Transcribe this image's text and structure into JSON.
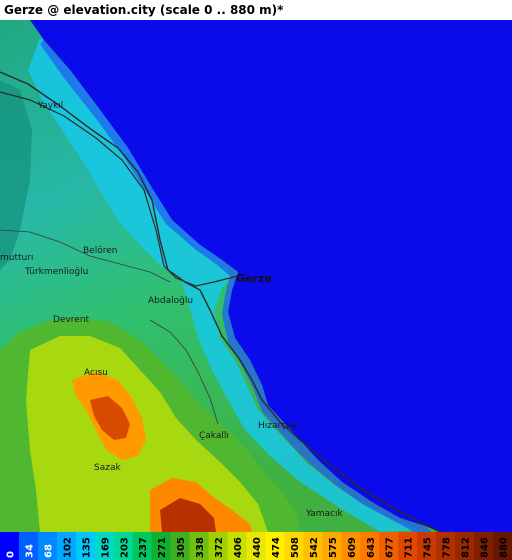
{
  "title": "Gerze @ elevation.city (scale 0 .. 880 m)*",
  "colors": {
    "sea": "#0a0aea",
    "road": "#2b2b2b"
  },
  "places": [
    {
      "name": "Yaykıl"
    },
    {
      "name": "Belören"
    },
    {
      "name": "mutturı"
    },
    {
      "name": "Türkmenlioğlu"
    },
    {
      "name": "Gerze"
    },
    {
      "name": "Abdaloğlu"
    },
    {
      "name": "Devrent"
    },
    {
      "name": "Acısu"
    },
    {
      "name": "Hızarçayı"
    },
    {
      "name": "Çakallı"
    },
    {
      "name": "Sazak"
    },
    {
      "name": "Yamacık"
    }
  ],
  "legend": {
    "ticks": [
      "0",
      "34",
      "68",
      "102",
      "135",
      "169",
      "203",
      "237",
      "271",
      "305",
      "338",
      "372",
      "406",
      "440",
      "474",
      "508",
      "542",
      "575",
      "609",
      "643",
      "677",
      "711",
      "745",
      "778",
      "812",
      "846",
      "880"
    ],
    "colors": [
      "#0000ff",
      "#0060ff",
      "#0088ff",
      "#00a8ff",
      "#00c8f8",
      "#00d8c8",
      "#00d898",
      "#00c860",
      "#10b030",
      "#40b020",
      "#70c010",
      "#a0d000",
      "#c8e000",
      "#e8e800",
      "#fff000",
      "#ffd800",
      "#ffc000",
      "#ffa800",
      "#ff9000",
      "#ff7800",
      "#f06000",
      "#e04800",
      "#c83800",
      "#b03000",
      "#982800",
      "#802000",
      "#681800"
    ]
  }
}
